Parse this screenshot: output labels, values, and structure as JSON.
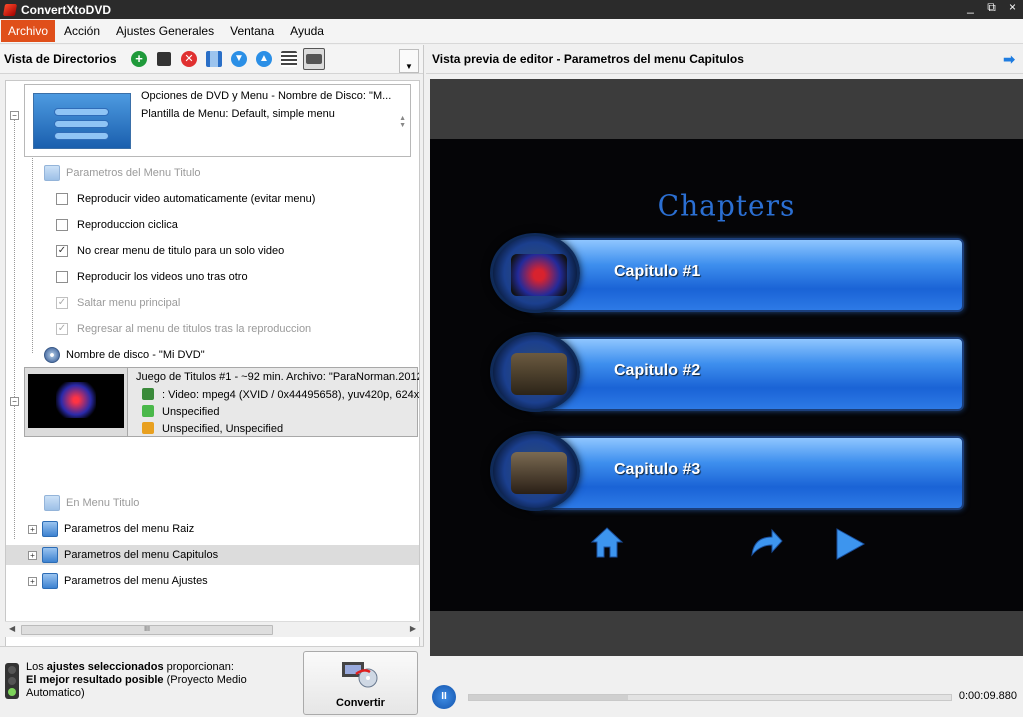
{
  "app": {
    "title": "ConvertXtoDVD"
  },
  "window_controls": {
    "minimize": "_",
    "restore": "⧉",
    "close": "×"
  },
  "menu": [
    "Archivo",
    "Acción",
    "Ajustes Generales",
    "Ventana",
    "Ayuda"
  ],
  "left_panel": {
    "title": "Vista de Directorios",
    "toolbar_icons": [
      "add-icon",
      "save-icon",
      "delete-icon",
      "chapters-icon",
      "move-down-icon",
      "move-up-icon",
      "list-view-icon",
      "preview-view-icon"
    ]
  },
  "dvd_card": {
    "line1": "Opciones de DVD y Menu - Nombre de Disco: \"M...",
    "line2": "Plantilla de Menu: Default, simple menu"
  },
  "options": {
    "group_label": "Parametros del Menu Titulo",
    "items": [
      {
        "label": "Reproducir video automaticamente (evitar menu)",
        "checked": false,
        "disabled": false
      },
      {
        "label": "Reproduccion ciclica",
        "checked": false,
        "disabled": false
      },
      {
        "label": "No crear menu de titulo para un solo video",
        "checked": true,
        "disabled": false
      },
      {
        "label": "Reproducir los videos uno tras otro",
        "checked": false,
        "disabled": false
      },
      {
        "label": "Saltar menu principal",
        "checked": true,
        "disabled": true
      },
      {
        "label": "Regresar al menu de titulos tras la reproduccion",
        "checked": true,
        "disabled": true
      }
    ],
    "disc_name": "Nombre de disco - \"Mi DVD\""
  },
  "title_card": {
    "line1": "Juego de Titulos #1 - ~92 min. Archivo: \"ParaNorman.2012",
    "line2": ": Video: mpeg4 (XVID / 0x44495658), yuv420p, 624x",
    "line3": "Unspecified",
    "line4": "Unspecified, Unspecified"
  },
  "tree_nodes": {
    "menu_title": "En Menu Titulo",
    "root": "Parametros del menu Raiz",
    "chapters": "Parametros del menu Capitulos",
    "settings": "Parametros del menu Ajustes"
  },
  "scroll": {
    "grip": "III"
  },
  "status": {
    "p1_a": "Los ",
    "p1_b": "ajustes seleccionados",
    "p1_c": " proporcionan:",
    "p2_a": "El mejor resultado posible",
    "p2_b": " (Proyecto Medio",
    "p3": "Automatico)"
  },
  "convert_button": {
    "label": "Convertir"
  },
  "right_panel": {
    "title": "Vista previa de editor - Parametros del menu Capitulos",
    "arrow": "➡"
  },
  "preview": {
    "menu_title": "Chapters",
    "chapters": [
      "Capitulo #1",
      "Capitulo #2",
      "Capitulo #3"
    ]
  },
  "player": {
    "time": "0:00:09.880",
    "progress": 0.33,
    "play_symbol": "II"
  },
  "colors": {
    "accent": "#e04f1a",
    "brand_blue": "#1e7ce0",
    "menu_button": "#3e8fee"
  }
}
